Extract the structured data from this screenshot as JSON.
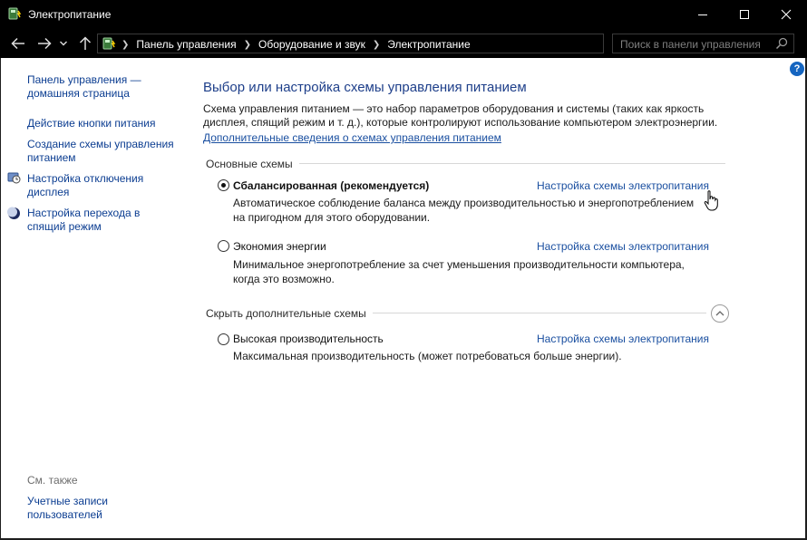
{
  "window": {
    "title": "Электропитание"
  },
  "address": {
    "crumbs": [
      "Панель управления",
      "Оборудование и звук",
      "Электропитание"
    ],
    "search_placeholder": "Поиск в панели управления"
  },
  "help": {
    "label": "?"
  },
  "sidebar": {
    "home_line1": "Панель управления —",
    "home_line2": "домашняя страница",
    "items": [
      {
        "line1": "Действие кнопки питания",
        "line2": ""
      },
      {
        "line1": "Создание схемы управления",
        "line2": "питанием"
      },
      {
        "line1": "Настройка отключения",
        "line2": "дисплея"
      },
      {
        "line1": "Настройка перехода в",
        "line2": "спящий режим"
      }
    ],
    "see_also": "См. также",
    "accounts_line1": "Учетные записи",
    "accounts_line2": "пользователей"
  },
  "main": {
    "title": "Выбор или настройка схемы управления питанием",
    "desc_line1": "Схема управления питанием — это набор параметров оборудования и системы (таких как яркость",
    "desc_line2": "дисплея, спящий режим и т. д.), которые контролируют использование компьютером электроэнергии.",
    "more_link": "Дополнительные сведения о схемах управления питанием",
    "basic_section": "Основные схемы",
    "extra_section": "Скрыть дополнительные схемы",
    "plans": [
      {
        "name": "Сбалансированная (рекомендуется)",
        "selected": true,
        "desc_line1": "Автоматическое соблюдение баланса между производительностью и энергопотреблением",
        "desc_line2": "на пригодном для этого оборудовании.",
        "link": "Настройка схемы электропитания"
      },
      {
        "name": "Экономия энергии",
        "selected": false,
        "desc_line1": "Минимальное энергопотребление за счет уменьшения производительности компьютера,",
        "desc_line2": "когда это возможно.",
        "link": "Настройка схемы электропитания"
      },
      {
        "name": "Высокая производительность",
        "selected": false,
        "desc_line1": "Максимальная производительность (может потребоваться больше энергии).",
        "desc_line2": "",
        "link": "Настройка схемы электропитания"
      }
    ]
  },
  "colors": {
    "title_blue": "#1e3f8a",
    "link_blue": "#1a4fa0",
    "chrome": "#000000"
  }
}
